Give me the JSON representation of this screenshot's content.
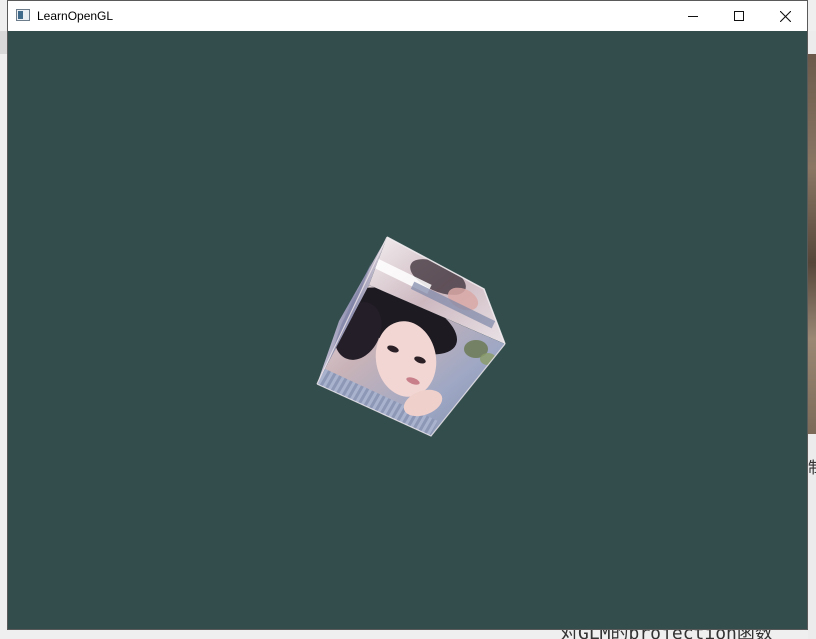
{
  "window": {
    "title": "LearnOpenGL",
    "clear_color": "#334d4d",
    "controls": {
      "minimize_icon": "minimize-icon",
      "maximize_icon": "maximize-icon",
      "close_icon": "close-icon"
    }
  },
  "scene": {
    "object": "textured-cube",
    "texture": "portrait-photo"
  },
  "background": {
    "right_edge_text": "制",
    "bottom_text": "对GLM的projection函数"
  }
}
